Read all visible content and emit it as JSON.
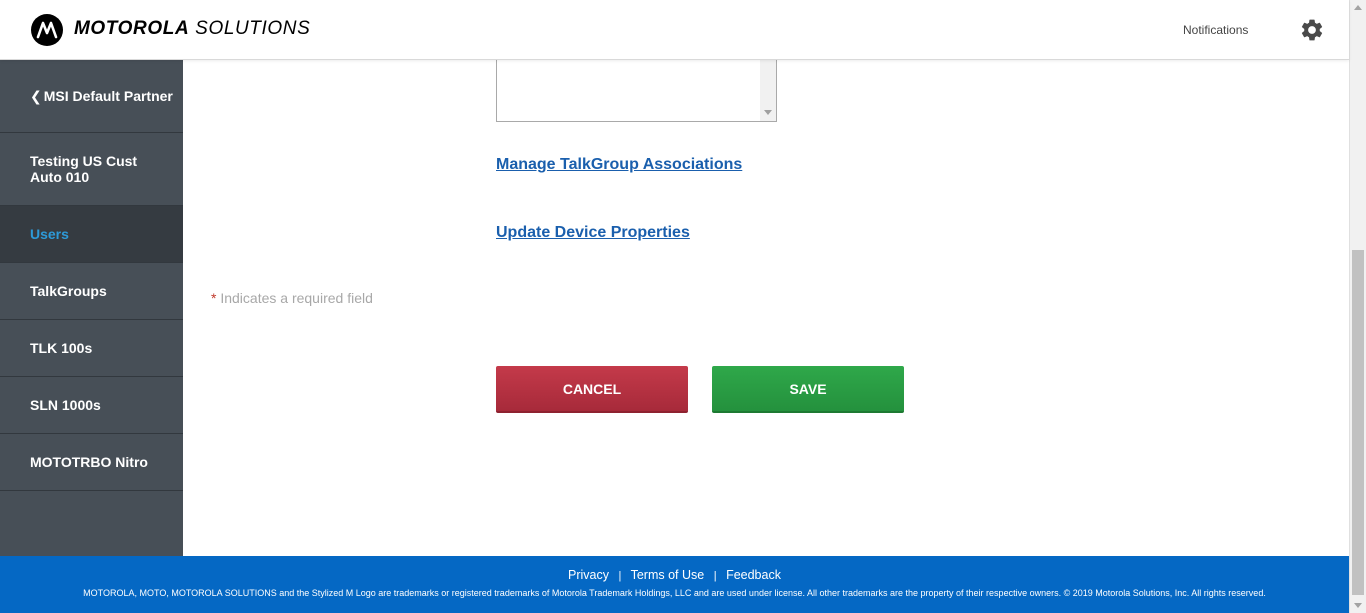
{
  "header": {
    "brand_bold": "MOTOROLA",
    "brand_light": "SOLUTIONS",
    "notifications_label": "Notifications",
    "settings_icon": "gear-icon"
  },
  "sidebar": {
    "items": [
      {
        "label": "MSI Default Partner",
        "icon": "chevron-left-icon"
      },
      {
        "label": "Testing US Cust Auto 010"
      },
      {
        "label": "Users",
        "active": true
      },
      {
        "label": "TalkGroups"
      },
      {
        "label": "TLK 100s"
      },
      {
        "label": "SLN 1000s"
      },
      {
        "label": "MOTOTRBO Nitro"
      }
    ]
  },
  "main": {
    "links": {
      "manage_talkgroups": "Manage TalkGroup Associations",
      "update_device": "Update Device Properties"
    },
    "required_star": "*",
    "required_note": "Indicates a required field",
    "buttons": {
      "cancel": "CANCEL",
      "save": "SAVE"
    }
  },
  "footer": {
    "links": [
      "Privacy",
      "Terms of Use",
      "Feedback"
    ],
    "separator": "|",
    "legal": "MOTOROLA, MOTO, MOTOROLA SOLUTIONS and the Stylized M Logo are trademarks or registered trademarks of Motorola Trademark Holdings, LLC and are used under license. All other trademarks are the property of their respective owners. © 2019 Motorola Solutions, Inc. All rights reserved."
  },
  "colors": {
    "sidebar_bg": "#474f57",
    "active_text": "#2d9ad8",
    "link": "#1a5fad",
    "cancel": "#b53142",
    "save": "#2a9c43",
    "footer_bg": "#0568c4"
  }
}
